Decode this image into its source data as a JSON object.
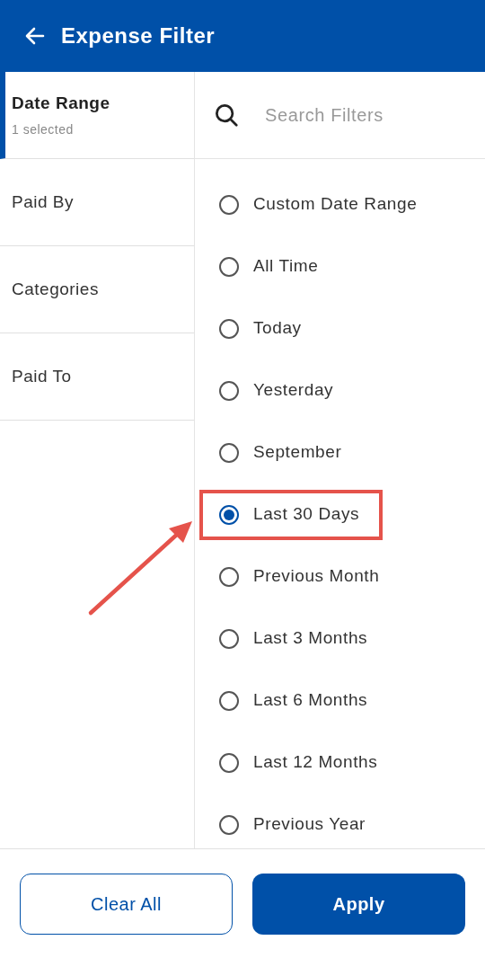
{
  "header": {
    "title": "Expense Filter"
  },
  "sidebar": {
    "items": [
      {
        "label": "Date Range",
        "sublabel": "1 selected",
        "selected": true
      },
      {
        "label": "Paid By",
        "selected": false
      },
      {
        "label": "Categories",
        "selected": false
      },
      {
        "label": "Paid To",
        "selected": false
      }
    ]
  },
  "search": {
    "placeholder": "Search Filters"
  },
  "options": [
    {
      "label": "Custom Date Range",
      "selected": false,
      "annotated": false
    },
    {
      "label": "All Time",
      "selected": false,
      "annotated": false
    },
    {
      "label": "Today",
      "selected": false,
      "annotated": false
    },
    {
      "label": "Yesterday",
      "selected": false,
      "annotated": false
    },
    {
      "label": "September",
      "selected": false,
      "annotated": false
    },
    {
      "label": "Last 30 Days",
      "selected": true,
      "annotated": true
    },
    {
      "label": "Previous Month",
      "selected": false,
      "annotated": false
    },
    {
      "label": "Last 3 Months",
      "selected": false,
      "annotated": false
    },
    {
      "label": "Last 6 Months",
      "selected": false,
      "annotated": false
    },
    {
      "label": "Last 12 Months",
      "selected": false,
      "annotated": false
    },
    {
      "label": "Previous Year",
      "selected": false,
      "annotated": false
    }
  ],
  "buttons": [
    {
      "label": "Clear All",
      "kind": "secondary"
    },
    {
      "label": "Apply",
      "kind": "primary"
    }
  ]
}
